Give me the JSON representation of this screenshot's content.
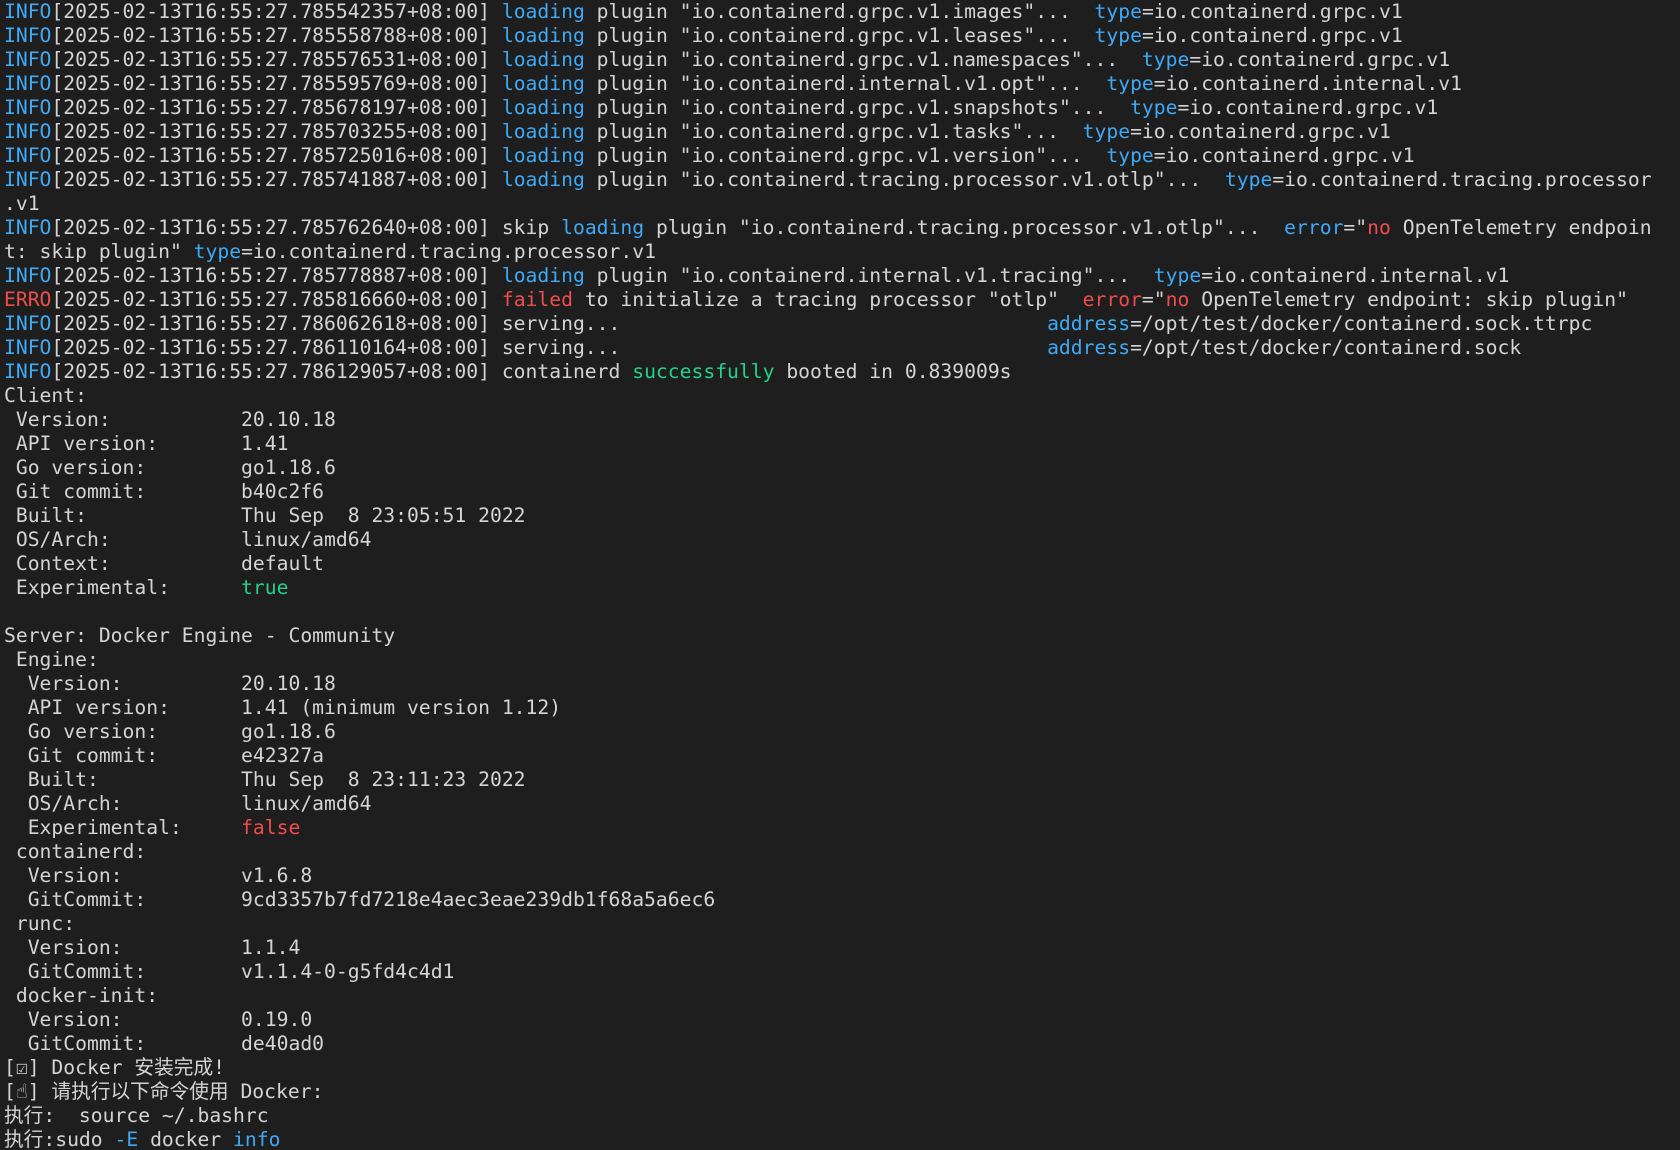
{
  "colors": {
    "background": "#1e1e1e",
    "foreground": "#d4d4d4",
    "blue": "#3fa9f5",
    "red": "#f14c4c",
    "green": "#23d18b"
  },
  "lines": [
    [
      [
        "blue",
        "INFO"
      ],
      [
        "default",
        "[2025-02-13T16:55:27.785542357+08:00] "
      ],
      [
        "blue",
        "loading"
      ],
      [
        "default",
        " plugin \"io.containerd.grpc.v1.images\"...  "
      ],
      [
        "blue",
        "type"
      ],
      [
        "default",
        "=io.containerd.grpc.v1"
      ]
    ],
    [
      [
        "blue",
        "INFO"
      ],
      [
        "default",
        "[2025-02-13T16:55:27.785558788+08:00] "
      ],
      [
        "blue",
        "loading"
      ],
      [
        "default",
        " plugin \"io.containerd.grpc.v1.leases\"...  "
      ],
      [
        "blue",
        "type"
      ],
      [
        "default",
        "=io.containerd.grpc.v1"
      ]
    ],
    [
      [
        "blue",
        "INFO"
      ],
      [
        "default",
        "[2025-02-13T16:55:27.785576531+08:00] "
      ],
      [
        "blue",
        "loading"
      ],
      [
        "default",
        " plugin \"io.containerd.grpc.v1.namespaces\"...  "
      ],
      [
        "blue",
        "type"
      ],
      [
        "default",
        "=io.containerd.grpc.v1"
      ]
    ],
    [
      [
        "blue",
        "INFO"
      ],
      [
        "default",
        "[2025-02-13T16:55:27.785595769+08:00] "
      ],
      [
        "blue",
        "loading"
      ],
      [
        "default",
        " plugin \"io.containerd.internal.v1.opt\"...  "
      ],
      [
        "blue",
        "type"
      ],
      [
        "default",
        "=io.containerd.internal.v1"
      ]
    ],
    [
      [
        "blue",
        "INFO"
      ],
      [
        "default",
        "[2025-02-13T16:55:27.785678197+08:00] "
      ],
      [
        "blue",
        "loading"
      ],
      [
        "default",
        " plugin \"io.containerd.grpc.v1.snapshots\"...  "
      ],
      [
        "blue",
        "type"
      ],
      [
        "default",
        "=io.containerd.grpc.v1"
      ]
    ],
    [
      [
        "blue",
        "INFO"
      ],
      [
        "default",
        "[2025-02-13T16:55:27.785703255+08:00] "
      ],
      [
        "blue",
        "loading"
      ],
      [
        "default",
        " plugin \"io.containerd.grpc.v1.tasks\"...  "
      ],
      [
        "blue",
        "type"
      ],
      [
        "default",
        "=io.containerd.grpc.v1"
      ]
    ],
    [
      [
        "blue",
        "INFO"
      ],
      [
        "default",
        "[2025-02-13T16:55:27.785725016+08:00] "
      ],
      [
        "blue",
        "loading"
      ],
      [
        "default",
        " plugin \"io.containerd.grpc.v1.version\"...  "
      ],
      [
        "blue",
        "type"
      ],
      [
        "default",
        "=io.containerd.grpc.v1"
      ]
    ],
    [
      [
        "blue",
        "INFO"
      ],
      [
        "default",
        "[2025-02-13T16:55:27.785741887+08:00] "
      ],
      [
        "blue",
        "loading"
      ],
      [
        "default",
        " plugin \"io.containerd.tracing.processor.v1.otlp\"...  "
      ],
      [
        "blue",
        "type"
      ],
      [
        "default",
        "=io.containerd.tracing.processor"
      ]
    ],
    [
      [
        "default",
        ".v1"
      ]
    ],
    [
      [
        "blue",
        "INFO"
      ],
      [
        "default",
        "[2025-02-13T16:55:27.785762640+08:00] skip "
      ],
      [
        "blue",
        "loading"
      ],
      [
        "default",
        " plugin \"io.containerd.tracing.processor.v1.otlp\"...  "
      ],
      [
        "blue",
        "error"
      ],
      [
        "default",
        "=\""
      ],
      [
        "red",
        "no"
      ],
      [
        "default",
        " OpenTelemetry endpoin"
      ]
    ],
    [
      [
        "default",
        "t: skip plugin\" "
      ],
      [
        "blue",
        "type"
      ],
      [
        "default",
        "=io.containerd.tracing.processor.v1"
      ]
    ],
    [
      [
        "blue",
        "INFO"
      ],
      [
        "default",
        "[2025-02-13T16:55:27.785778887+08:00] "
      ],
      [
        "blue",
        "loading"
      ],
      [
        "default",
        " plugin \"io.containerd.internal.v1.tracing\"...  "
      ],
      [
        "blue",
        "type"
      ],
      [
        "default",
        "=io.containerd.internal.v1"
      ]
    ],
    [
      [
        "red",
        "ERRO"
      ],
      [
        "default",
        "[2025-02-13T16:55:27.785816660+08:00] "
      ],
      [
        "red",
        "failed"
      ],
      [
        "default",
        " to initialize a tracing processor \"otlp\"  "
      ],
      [
        "red",
        "error"
      ],
      [
        "default",
        "=\""
      ],
      [
        "red",
        "no"
      ],
      [
        "default",
        " OpenTelemetry endpoint: skip plugin\""
      ]
    ],
    [
      [
        "blue",
        "INFO"
      ],
      [
        "default",
        "[2025-02-13T16:55:27.786062618+08:00] serving...                                    "
      ],
      [
        "blue",
        "address"
      ],
      [
        "default",
        "=/opt/test/docker/containerd.sock.ttrpc"
      ]
    ],
    [
      [
        "blue",
        "INFO"
      ],
      [
        "default",
        "[2025-02-13T16:55:27.786110164+08:00] serving...                                    "
      ],
      [
        "blue",
        "address"
      ],
      [
        "default",
        "=/opt/test/docker/containerd.sock"
      ]
    ],
    [
      [
        "blue",
        "INFO"
      ],
      [
        "default",
        "[2025-02-13T16:55:27.786129057+08:00] containerd "
      ],
      [
        "green",
        "successfully"
      ],
      [
        "default",
        " booted in 0.839009s"
      ]
    ],
    [
      [
        "default",
        "Client:"
      ]
    ],
    [
      [
        "default",
        " Version:           20.10.18"
      ]
    ],
    [
      [
        "default",
        " API version:       1.41"
      ]
    ],
    [
      [
        "default",
        " Go version:        go1.18.6"
      ]
    ],
    [
      [
        "default",
        " Git commit:        b40c2f6"
      ]
    ],
    [
      [
        "default",
        " Built:             Thu Sep  8 23:05:51 2022"
      ]
    ],
    [
      [
        "default",
        " OS/Arch:           linux/amd64"
      ]
    ],
    [
      [
        "default",
        " Context:           default"
      ]
    ],
    [
      [
        "default",
        " Experimental:      "
      ],
      [
        "green",
        "true"
      ]
    ],
    [
      [
        "default",
        ""
      ]
    ],
    [
      [
        "default",
        "Server: Docker Engine - Community"
      ]
    ],
    [
      [
        "default",
        " Engine:"
      ]
    ],
    [
      [
        "default",
        "  Version:          20.10.18"
      ]
    ],
    [
      [
        "default",
        "  API version:      1.41 (minimum version 1.12)"
      ]
    ],
    [
      [
        "default",
        "  Go version:       go1.18.6"
      ]
    ],
    [
      [
        "default",
        "  Git commit:       e42327a"
      ]
    ],
    [
      [
        "default",
        "  Built:            Thu Sep  8 23:11:23 2022"
      ]
    ],
    [
      [
        "default",
        "  OS/Arch:          linux/amd64"
      ]
    ],
    [
      [
        "default",
        "  Experimental:     "
      ],
      [
        "red",
        "false"
      ]
    ],
    [
      [
        "default",
        " containerd:"
      ]
    ],
    [
      [
        "default",
        "  Version:          v1.6.8"
      ]
    ],
    [
      [
        "default",
        "  GitCommit:        9cd3357b7fd7218e4aec3eae239db1f68a5a6ec6"
      ]
    ],
    [
      [
        "default",
        " runc:"
      ]
    ],
    [
      [
        "default",
        "  Version:          1.1.4"
      ]
    ],
    [
      [
        "default",
        "  GitCommit:        v1.1.4-0-g5fd4c4d1"
      ]
    ],
    [
      [
        "default",
        " docker-init:"
      ]
    ],
    [
      [
        "default",
        "  Version:          0.19.0"
      ]
    ],
    [
      [
        "default",
        "  GitCommit:        de40ad0"
      ]
    ],
    [
      [
        "default",
        "[☑] Docker 安装完成!"
      ]
    ],
    [
      [
        "default",
        "[☝] 请执行以下命令使用 Docker:"
      ]
    ],
    [
      [
        "default",
        "执行:  source ~/.bashrc"
      ]
    ],
    [
      [
        "default",
        "执行:sudo "
      ],
      [
        "blue",
        "-E"
      ],
      [
        "default",
        " docker "
      ],
      [
        "blue",
        "info"
      ]
    ]
  ]
}
